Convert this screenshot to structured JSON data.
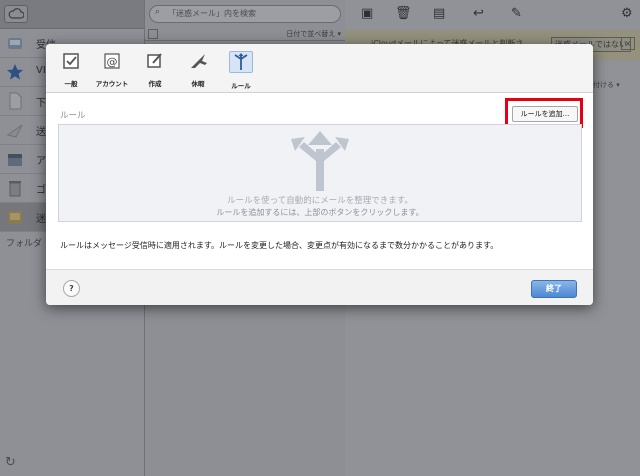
{
  "sidebar": {
    "items": [
      {
        "label": "受信",
        "icon": "inbox-icon"
      },
      {
        "label": "VIP",
        "icon": "star-icon"
      },
      {
        "label": "下",
        "icon": "document-icon"
      },
      {
        "label": "送",
        "icon": "sent-icon"
      },
      {
        "label": "ア",
        "icon": "archive-icon"
      },
      {
        "label": "ゴ",
        "icon": "trash-icon"
      },
      {
        "label": "迷",
        "icon": "junk-icon"
      }
    ],
    "folders_label": "フォルダ"
  },
  "list": {
    "search_placeholder": "「迷惑メール」内を検索",
    "sort_label": "日付で並べ替え ▾"
  },
  "reader": {
    "banner_text": "iCloudメールによって迷惑メールと判断さ",
    "banner_button": "迷惑メールではない",
    "banner_close": "×",
    "fragment": "付ける ▾"
  },
  "modal": {
    "tabs": [
      {
        "label": "一般",
        "icon": "checkbox-icon"
      },
      {
        "label": "アカウント",
        "icon": "at-icon"
      },
      {
        "label": "作成",
        "icon": "compose-icon"
      },
      {
        "label": "休暇",
        "icon": "airplane-icon"
      },
      {
        "label": "ルール",
        "icon": "rules-icon"
      }
    ],
    "active_tab": "ルール",
    "section_label": "ルール",
    "add_rule_button": "ルールを追加...",
    "empty_message": "ルールを使って自動的にメールを整理できます。",
    "empty_hint": "ルールを追加するには、上部のボタンをクリックします。",
    "note": "ルールはメッセージ受信時に適用されます。ルールを変更した場合、変更点が有効になるまで数分かかることがあります。",
    "help_button": "?",
    "done_button": "終了"
  },
  "colors": {
    "highlight": "#e60012",
    "primary_button": "#4d86d3"
  }
}
